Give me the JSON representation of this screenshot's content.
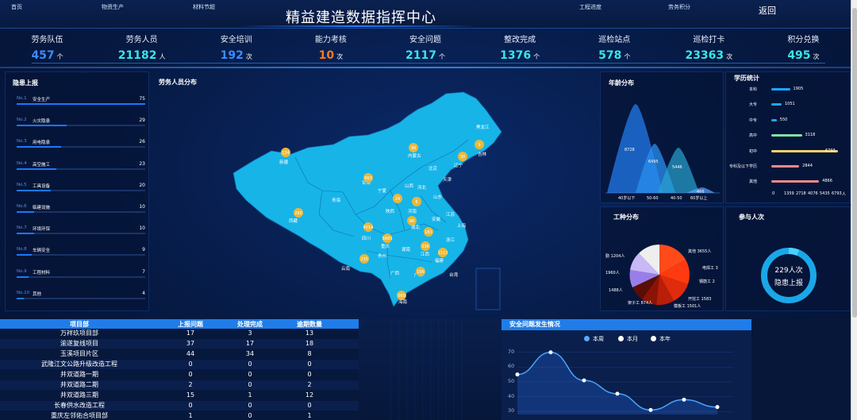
{
  "nav": {
    "left": [
      "首页",
      "物资生产",
      "材料节超"
    ],
    "right": [
      "工程进度",
      "劳务积分"
    ],
    "back_label": "返回"
  },
  "title": "精益建造数据指挥中心",
  "stats": [
    {
      "label": "劳务队伍",
      "value": "457",
      "unit": "个",
      "color": "#3b8cff"
    },
    {
      "label": "劳务人员",
      "value": "21182",
      "unit": "人",
      "color": "#37e6e6"
    },
    {
      "label": "安全培训",
      "value": "192",
      "unit": "次",
      "color": "#3b8cff"
    },
    {
      "label": "能力考核",
      "value": "10",
      "unit": "次",
      "color": "#ff7a1a"
    },
    {
      "label": "安全问题",
      "value": "2117",
      "unit": "个",
      "color": "#37e6e6"
    },
    {
      "label": "整改完成",
      "value": "1376",
      "unit": "个",
      "color": "#37e6e6"
    },
    {
      "label": "巡检站点",
      "value": "578",
      "unit": "个",
      "color": "#37e6e6"
    },
    {
      "label": "巡检打卡",
      "value": "23363",
      "unit": "次",
      "color": "#37e6e6"
    },
    {
      "label": "积分兑换",
      "value": "495",
      "unit": "次",
      "color": "#37e6e6"
    }
  ],
  "hazards": {
    "title": "隐患上报",
    "items": [
      {
        "no": "No.1",
        "name": "安全生产",
        "value": 75
      },
      {
        "no": "No.2",
        "name": "火灾隐患",
        "value": 29
      },
      {
        "no": "No.3",
        "name": "用电隐患",
        "value": 26
      },
      {
        "no": "No.4",
        "name": "高空施工",
        "value": 23
      },
      {
        "no": "No.5",
        "name": "工具设备",
        "value": 20
      },
      {
        "no": "No.6",
        "name": "临建设施",
        "value": 10
      },
      {
        "no": "No.7",
        "name": "环境环保",
        "value": 10
      },
      {
        "no": "No.8",
        "name": "车辆安全",
        "value": 9
      },
      {
        "no": "No.9",
        "name": "工程材料",
        "value": 7
      },
      {
        "no": "No.10",
        "name": "其他",
        "value": 4
      }
    ]
  },
  "map": {
    "title": "劳务人员分布",
    "provinces": [
      "黑龙江",
      "吉林",
      "辽宁",
      "内蒙古",
      "北京",
      "天津",
      "河北",
      "山西",
      "山东",
      "河南",
      "陕西",
      "宁夏",
      "甘肃",
      "青海",
      "新疆",
      "西藏",
      "四川",
      "重庆",
      "湖北",
      "安徽",
      "江苏",
      "上海",
      "浙江",
      "江西",
      "湖南",
      "贵州",
      "云南",
      "广西",
      "广东",
      "福建",
      "台湾",
      "海南"
    ],
    "markers": [
      {
        "value": "124"
      },
      {
        "value": "98"
      },
      {
        "value": "9"
      },
      {
        "value": "30"
      },
      {
        "value": "863"
      },
      {
        "value": "24"
      },
      {
        "value": "6"
      },
      {
        "value": "290"
      },
      {
        "value": "4014"
      },
      {
        "value": "96"
      },
      {
        "value": "183"
      },
      {
        "value": "5683"
      },
      {
        "value": "336"
      },
      {
        "value": "2113"
      },
      {
        "value": "235"
      },
      {
        "value": "196"
      },
      {
        "value": "560"
      }
    ]
  },
  "age": {
    "title": "年龄分布",
    "values": [
      "8728",
      "6495",
      "5446",
      "466"
    ],
    "labels": [
      "40岁以下",
      "50-60",
      "40-50",
      "60岁以上"
    ]
  },
  "education": {
    "title": "学历统计",
    "items": [
      {
        "label": "本科",
        "value": 1905,
        "color": "#1aa7ff"
      },
      {
        "label": "大专",
        "value": 1051,
        "color": "#1aa7ff"
      },
      {
        "label": "中专",
        "value": 550,
        "color": "#1aa7ff"
      },
      {
        "label": "高中",
        "value": 3118,
        "color": "#7fe0a6"
      },
      {
        "label": "初中",
        "value": 6793,
        "color": "#f5d36b"
      },
      {
        "label": "专科及以下学历",
        "value": 2844,
        "color": "#f08a8a"
      },
      {
        "label": "其他",
        "value": 4866,
        "color": "#f08a8a"
      }
    ],
    "axis": [
      "0",
      "1359",
      "2718",
      "4076",
      "5435",
      "6793"
    ],
    "unit": "人"
  },
  "trades": {
    "title": "工种分布",
    "labels": [
      "其他 3655人",
      "电焊工 3",
      "钢筋工 2",
      "开挖工 1583",
      "模板工 1501人",
      "架子工 874人",
      "1488人",
      "1960人",
      "勤 1204人"
    ],
    "unreadable_labels": [
      "...工 30人",
      "...操 244人"
    ]
  },
  "participation": {
    "title": "参与人次",
    "value": "229人次",
    "caption": "隐患上报"
  },
  "table": {
    "headers": [
      "项目部",
      "上报问题",
      "处理完成",
      "逾期数量"
    ],
    "rows": [
      [
        "万祥玖项目部",
        "17",
        "3",
        "13"
      ],
      [
        "渝遂复线项目",
        "37",
        "17",
        "18"
      ],
      [
        "玉溪项目片区",
        "44",
        "34",
        "8"
      ],
      [
        "武隆江文公路升级改造工程",
        "0",
        "0",
        "0"
      ],
      [
        "井双道路一期",
        "0",
        "0",
        "0"
      ],
      [
        "井双道路二期",
        "2",
        "0",
        "2"
      ],
      [
        "井双道路三期",
        "15",
        "1",
        "12"
      ],
      [
        "长春供水改造工程",
        "0",
        "0",
        "0"
      ],
      [
        "重庆左邻佑合项目部",
        "1",
        "0",
        "1"
      ]
    ]
  },
  "safety_chart": {
    "title": "安全问题发生情况",
    "legend": [
      "本周",
      "本月",
      "本年"
    ],
    "legend_colors": [
      "#5aa7ff",
      "#ffffff",
      "#ffffff"
    ],
    "y_ticks": [
      "70",
      "60",
      "50",
      "40",
      "30"
    ],
    "chart_data": {
      "type": "line",
      "series": [
        {
          "name": "本周",
          "values": [
            55,
            70,
            51,
            42,
            31,
            38,
            33
          ]
        }
      ],
      "ylim": [
        28,
        72
      ]
    }
  }
}
